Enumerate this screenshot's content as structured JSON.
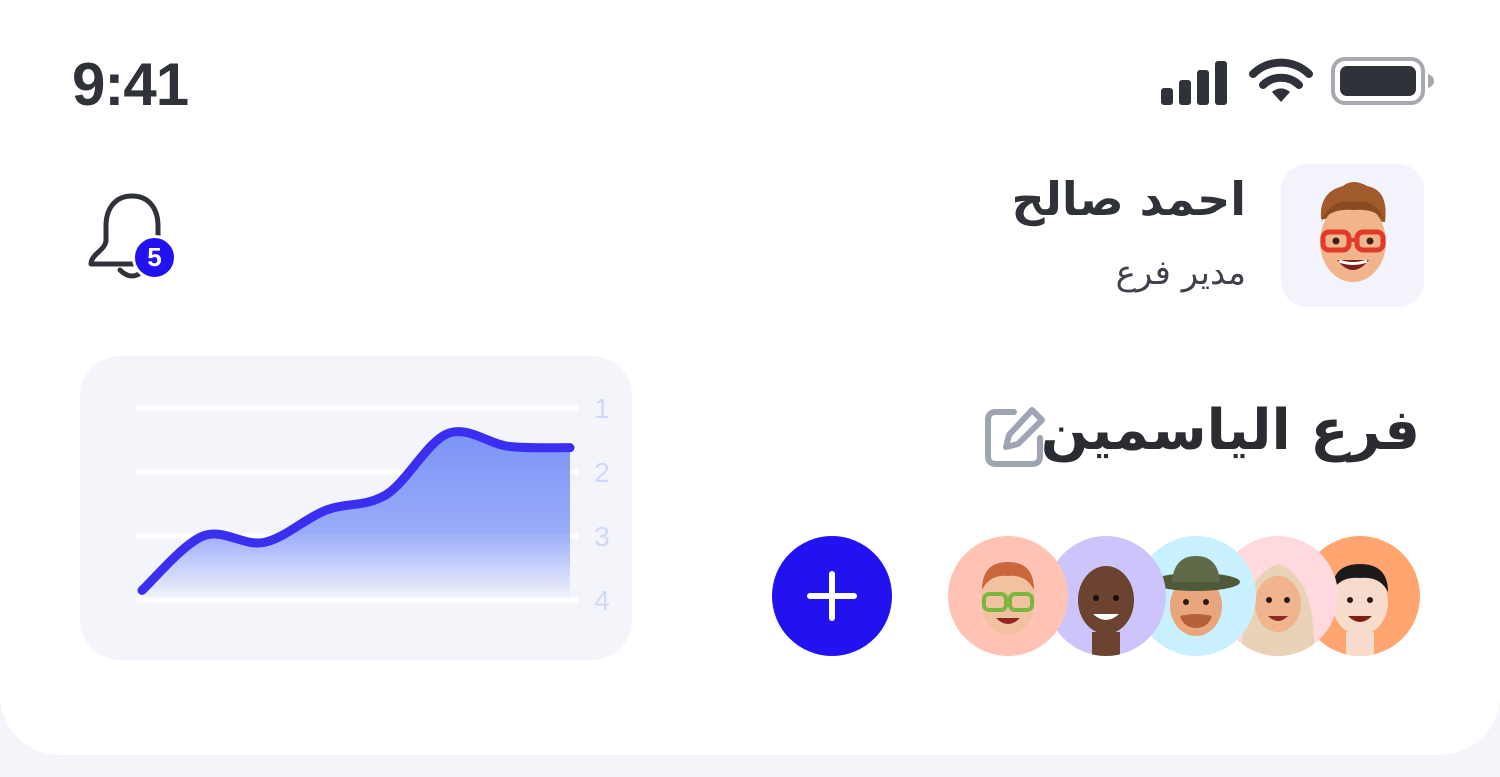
{
  "status_bar": {
    "time": "9:41",
    "icons": [
      "cellular-signal-icon",
      "wifi-icon",
      "battery-icon"
    ]
  },
  "header": {
    "notifications": {
      "icon": "bell-icon",
      "badge_count": "5"
    },
    "user": {
      "name": "احمد صالح",
      "role": "مدير فرع",
      "avatar": "memoji-glasses-avatar"
    }
  },
  "branch": {
    "name": "فرع الياسمين",
    "edit_icon": "edit-icon",
    "add_member_icon": "plus-icon",
    "members": [
      {
        "avatar": "memoji-orange",
        "bg": "#ffa570"
      },
      {
        "avatar": "memoji-hijab",
        "bg": "#ffd9de"
      },
      {
        "avatar": "memoji-hat",
        "bg": "#c9f0ff"
      },
      {
        "avatar": "memoji-purple",
        "bg": "#cdc4fb"
      },
      {
        "avatar": "memoji-salmon",
        "bg": "#ffc3b6"
      }
    ]
  },
  "colors": {
    "accent": "#2212f0",
    "chart_line": "#3a2ff0",
    "chart_fill": "#7b93f7",
    "tick": "#cfd8fa"
  },
  "chart_data": {
    "type": "area",
    "title": "",
    "xlabel": "",
    "ylabel": "",
    "y_ticks": [
      "1",
      "2",
      "3",
      "4"
    ],
    "ylim": [
      4,
      1
    ],
    "y_axis_side": "right",
    "grid": true,
    "x": [
      0,
      1,
      2,
      3,
      4,
      5,
      6,
      7
    ],
    "values": [
      3.85,
      3.0,
      3.1,
      2.6,
      2.35,
      1.4,
      1.6,
      1.62
    ]
  }
}
